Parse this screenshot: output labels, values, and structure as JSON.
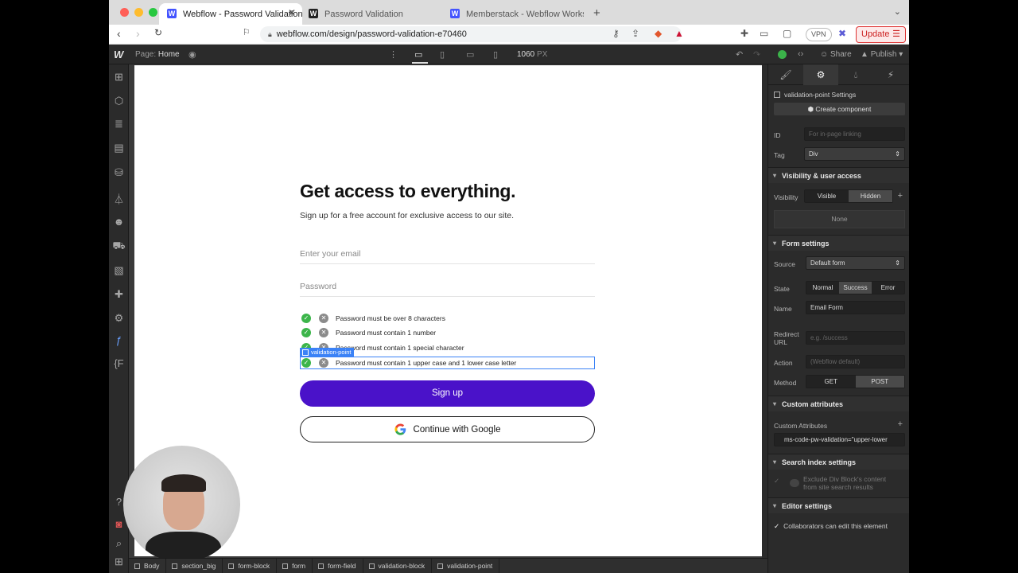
{
  "browser": {
    "tabs": [
      {
        "title": "Webflow - Password Validation",
        "favicon": "W",
        "favicon_color": "#4353ff",
        "active": true
      },
      {
        "title": "Password Validation",
        "favicon": "W",
        "favicon_color": "#222222",
        "active": false
      },
      {
        "title": "Memberstack - Webflow Workspace",
        "favicon": "W",
        "favicon_color": "#4353ff",
        "active": false
      }
    ],
    "url": "webflow.com/design/password-validation-e70460",
    "vpn_label": "VPN",
    "update_label": "Update"
  },
  "wf_top": {
    "page_prefix": "Page:",
    "page_name": "Home",
    "canvas_width": "1060",
    "canvas_unit": "PX",
    "share_label": "Share",
    "publish_label": "Publish"
  },
  "canvas": {
    "title": "Get access to everything.",
    "subtitle": "Sign up for a free account for exclusive access to our site.",
    "email_placeholder": "Enter your email",
    "password_placeholder": "Password",
    "validation_points": [
      "Password must be over 8 characters",
      "Password must contain 1 number",
      "Password must contain 1 special character",
      "Password must contain 1 upper case and 1 lower case letter"
    ],
    "selected_tag": "validation-point",
    "signup_label": "Sign up",
    "google_label": "Continue with Google"
  },
  "breadcrumbs": [
    "Body",
    "section_big",
    "form-block",
    "form",
    "form-field",
    "validation-block",
    "validation-point"
  ],
  "panel": {
    "element_settings": "validation-point Settings",
    "create_component": "Create component",
    "id_label": "ID",
    "id_placeholder": "For in-page linking",
    "tag_label": "Tag",
    "tag_value": "Div",
    "visibility_section": "Visibility & user access",
    "visibility_label": "Visibility",
    "visibility_options": [
      "Visible",
      "Hidden"
    ],
    "visibility_none": "None",
    "form_section": "Form settings",
    "source_label": "Source",
    "source_value": "Default form",
    "state_label": "State",
    "state_options": [
      "Normal",
      "Success",
      "Error"
    ],
    "name_label": "Name",
    "name_value": "Email Form",
    "redirect_label_1": "Redirect",
    "redirect_label_2": "URL",
    "redirect_placeholder": "e.g. /success",
    "action_label": "Action",
    "action_placeholder": "(Webflow default)",
    "method_label": "Method",
    "method_options": [
      "GET",
      "POST"
    ],
    "custom_attr_section": "Custom attributes",
    "custom_attr_label": "Custom Attributes",
    "custom_attr_value": "ms-code-pw-validation=\"upper-lower",
    "search_section": "Search index settings",
    "search_exclude_1": "Exclude Div Block's content",
    "search_exclude_2": "from site search results",
    "editor_section": "Editor settings",
    "editor_collab": "Collaborators can edit this element"
  },
  "colors": {
    "brand_purple": "#4a12c9",
    "valid_green": "#3cb54a",
    "selection_blue": "#3b82f6"
  }
}
